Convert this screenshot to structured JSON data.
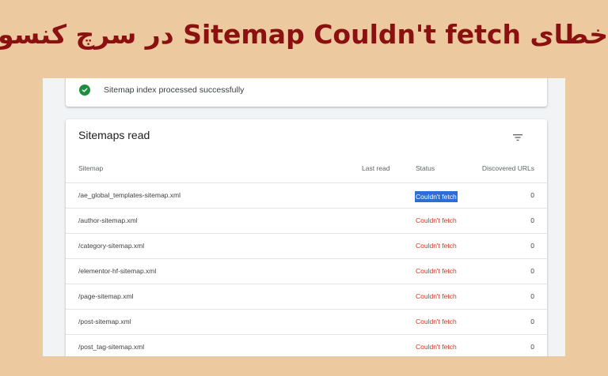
{
  "banner": {
    "title": "خطای Sitemap Couldn't fetch در سرچ کنسول"
  },
  "status_card": {
    "icon": "check-circle-icon",
    "message": "Sitemap index processed successfully",
    "color": "#1e8e3e"
  },
  "sitemaps_card": {
    "title": "Sitemaps read",
    "filter_icon": "filter-icon",
    "columns": {
      "sitemap": "Sitemap",
      "last_read": "Last read",
      "status": "Status",
      "discovered": "Discovered URLs"
    },
    "rows": [
      {
        "sitemap": "/ae_global_templates-sitemap.xml",
        "last_read": "",
        "status": "Couldn't fetch",
        "discovered": "0",
        "selected": true
      },
      {
        "sitemap": "/author-sitemap.xml",
        "last_read": "",
        "status": "Couldn't fetch",
        "discovered": "0"
      },
      {
        "sitemap": "/category-sitemap.xml",
        "last_read": "",
        "status": "Couldn't fetch",
        "discovered": "0"
      },
      {
        "sitemap": "/elementor-hf-sitemap.xml",
        "last_read": "",
        "status": "Couldn't fetch",
        "discovered": "0"
      },
      {
        "sitemap": "/page-sitemap.xml",
        "last_read": "",
        "status": "Couldn't fetch",
        "discovered": "0"
      },
      {
        "sitemap": "/post-sitemap.xml",
        "last_read": "",
        "status": "Couldn't fetch",
        "discovered": "0"
      },
      {
        "sitemap": "/post_tag-sitemap.xml",
        "last_read": "",
        "status": "Couldn't fetch",
        "discovered": "0"
      }
    ],
    "error_color": "#d93025",
    "selection_color": "#2b6fd6"
  },
  "background_color": "#ecc99f",
  "title_color": "#8b1111"
}
